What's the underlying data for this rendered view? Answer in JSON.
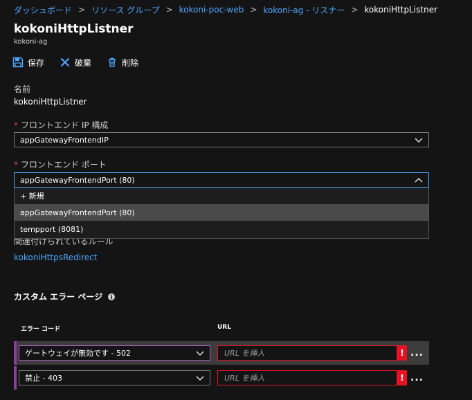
{
  "breadcrumb": [
    {
      "label": "ダッシュボード"
    },
    {
      "label": "リソース グループ"
    },
    {
      "label": "kokoni-poc-web"
    },
    {
      "label": "kokoni-ag - リスナー"
    },
    {
      "label": "kokoniHttpListner"
    }
  ],
  "header": {
    "title": "kokoniHttpListner",
    "subtitle": "kokoni-ag"
  },
  "toolbar": {
    "save_label": "保存",
    "discard_label": "破棄",
    "delete_label": "削除"
  },
  "form": {
    "name_label": "名前",
    "name_value": "kokoniHttpListner",
    "frontend_ip_label": "フロントエンド IP 構成",
    "frontend_ip_value": "appGatewayFrontendIP",
    "frontend_port_label": "フロントエンド ポート",
    "frontend_port_value": "appGatewayFrontendPort (80)",
    "required_mark": "*",
    "port_options": [
      {
        "label": "+ 新規"
      },
      {
        "label": "appGatewayFrontendPort (80)",
        "selected": true
      },
      {
        "label": "tempport (8081)"
      }
    ],
    "associated_rule_label": "関連付けられているルール",
    "associated_rule_value": "kokoniHttpsRedirect"
  },
  "custom_errors": {
    "title": "カスタム エラー ページ",
    "info_icon": "i",
    "col_error_code": "エラー コード",
    "col_url": "URL",
    "rows": [
      {
        "code": "ゲートウェイが無効です - 502",
        "url_placeholder": "URL を挿入",
        "error_mark": "!",
        "more": "..."
      },
      {
        "code": "禁止 - 403",
        "url_placeholder": "URL を挿入",
        "error_mark": "!",
        "more": "..."
      }
    ]
  },
  "colors": {
    "background": "#141414",
    "link": "#4da6ff",
    "required": "#e04040",
    "error": "#e81123",
    "row_accent": "#8a3f9a",
    "selected_option": "#4a4a4a"
  }
}
